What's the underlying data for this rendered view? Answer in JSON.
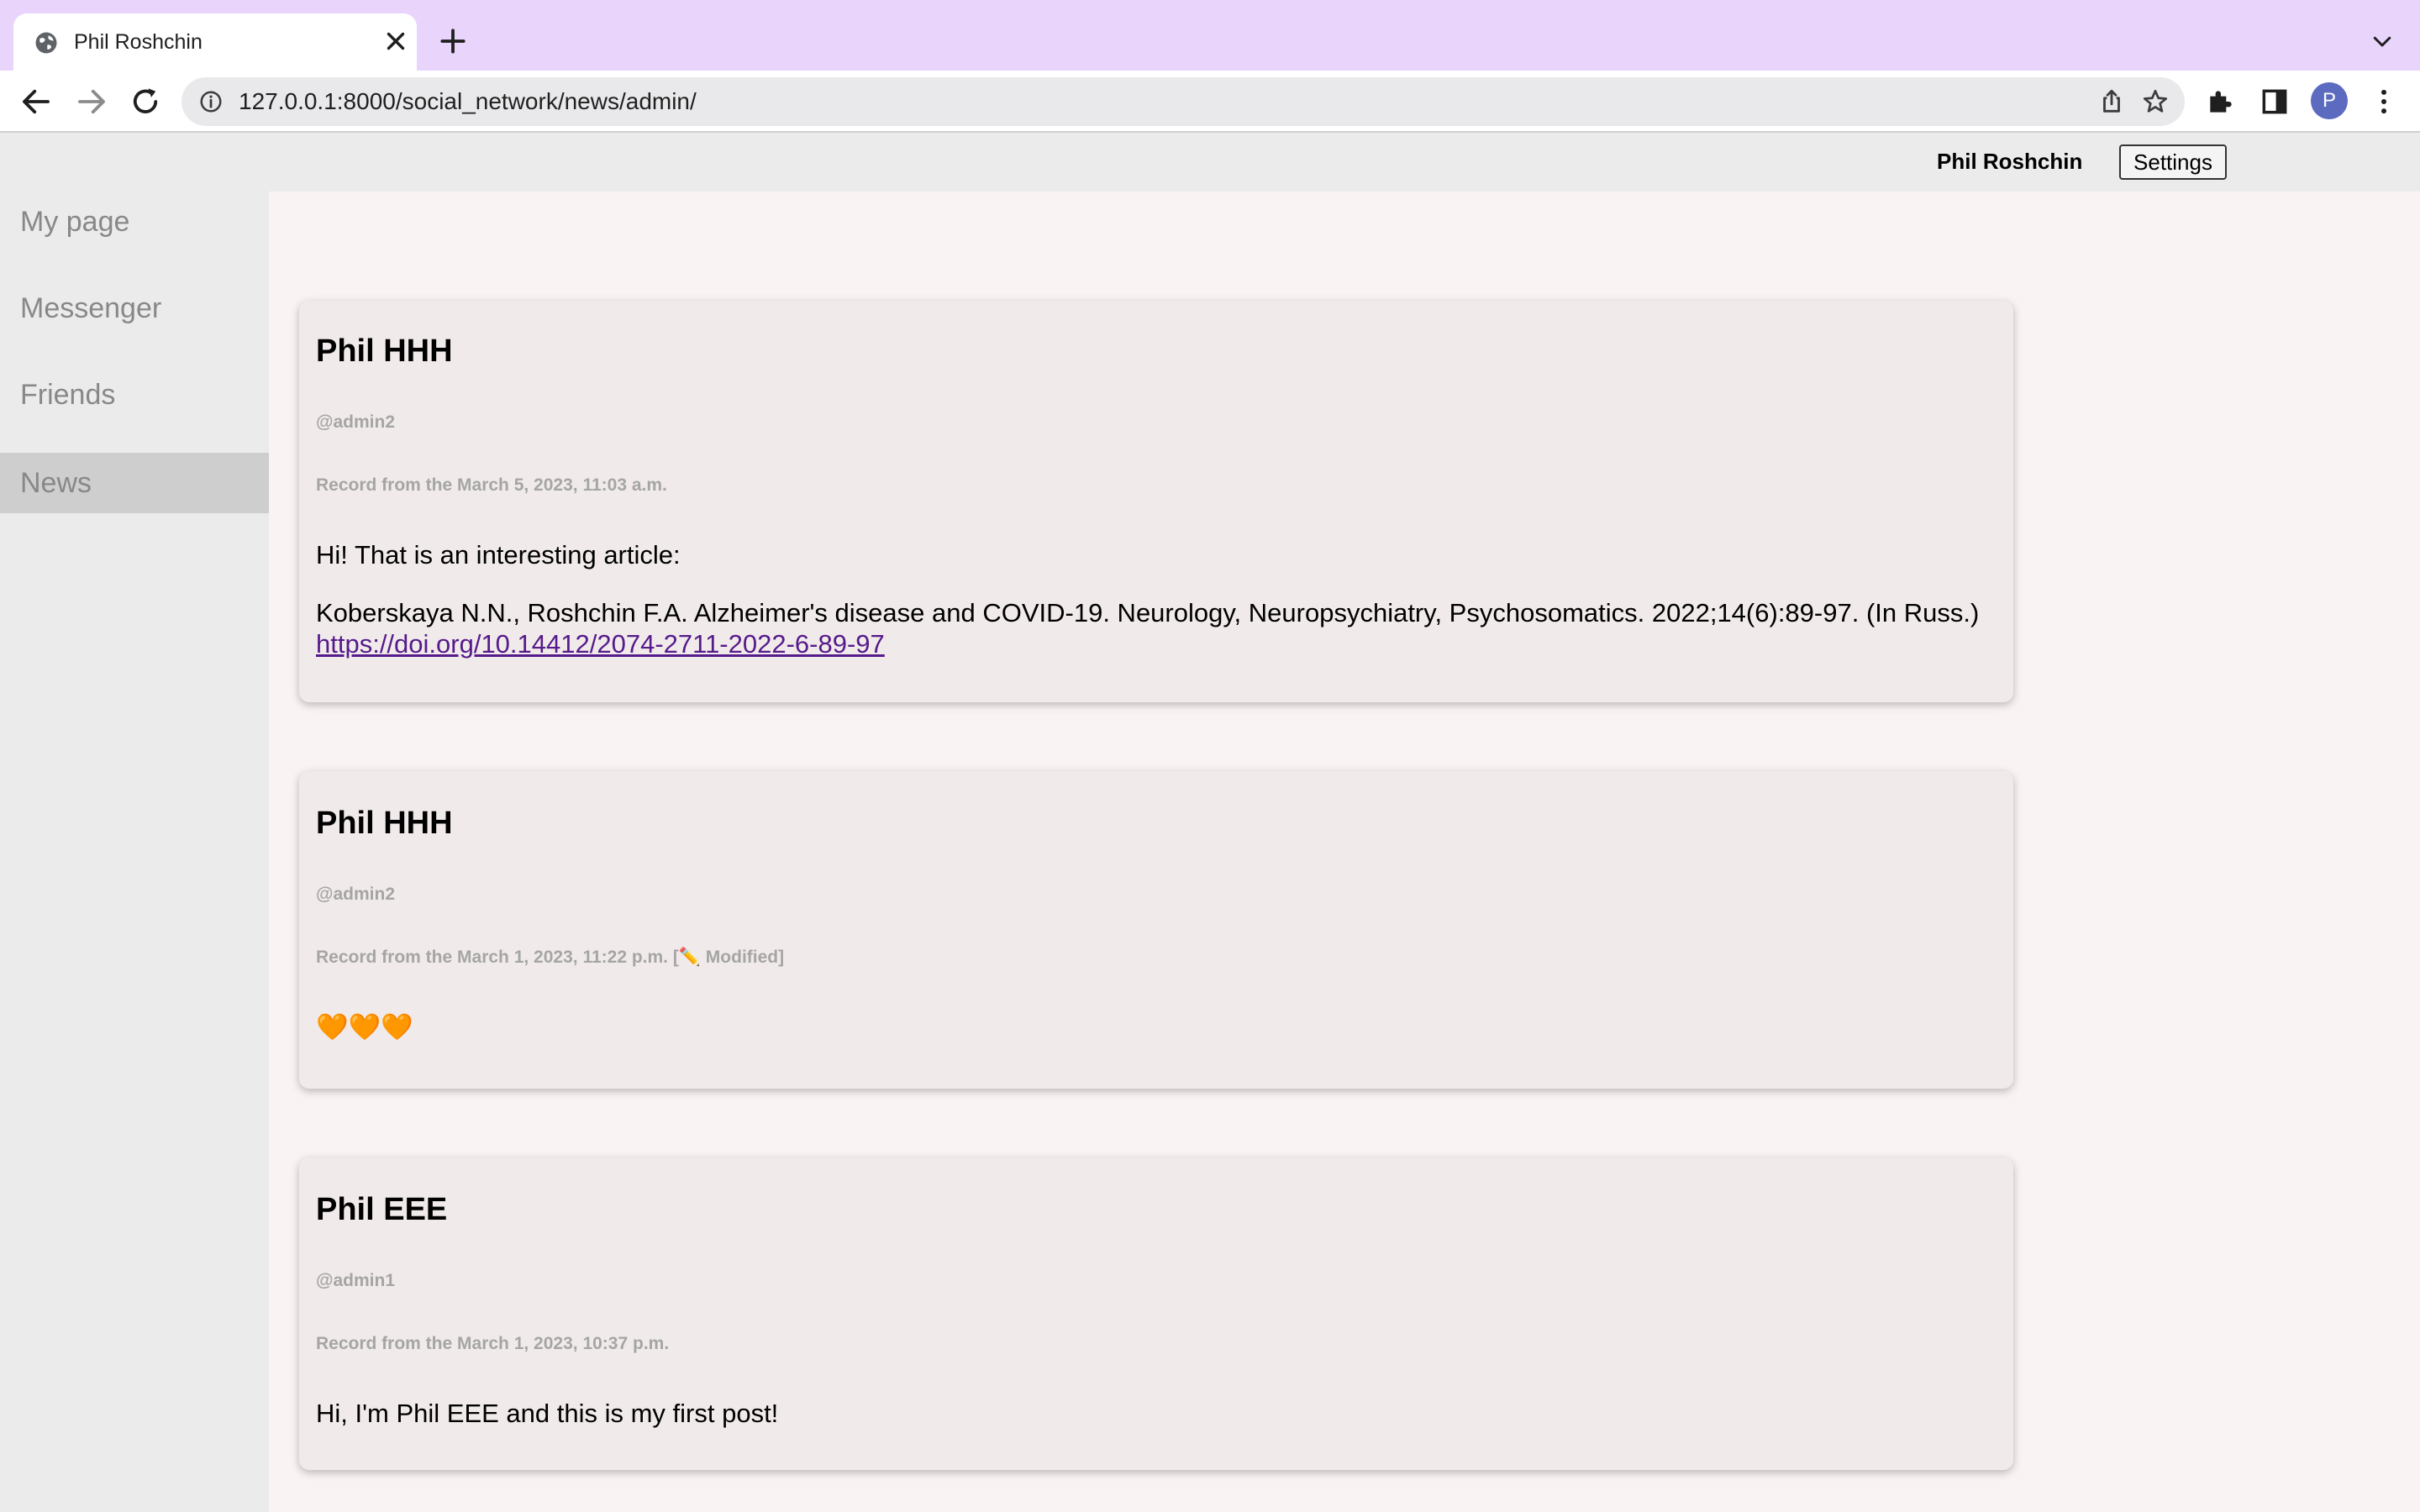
{
  "browser": {
    "tab_title": "Phil Roshchin",
    "url": "127.0.0.1:8000/social_network/news/admin/",
    "avatar_letter": "P"
  },
  "header": {
    "user_name": "Phil Roshchin",
    "settings_label": "Settings"
  },
  "sidebar": {
    "items": [
      {
        "label": "My page"
      },
      {
        "label": "Messenger"
      },
      {
        "label": "Friends"
      },
      {
        "label": "News",
        "active": true
      }
    ]
  },
  "posts": [
    {
      "author": "Phil HHH",
      "handle": "@admin2",
      "date": "Record from the March 5, 2023, 11:03 a.m.",
      "text": "Hi! That is an interesting article:",
      "text2": "Koberskaya N.N., Roshchin F.A. Alzheimer's disease and COVID-19. Neurology, Neuropsychiatry, Psychosomatics. 2022;14(6):89-97. (In Russ.) ",
      "link": "https://doi.org/10.14412/2074-2711-2022-6-89-97"
    },
    {
      "author": "Phil HHH",
      "handle": "@admin2",
      "date": "Record from the March 1, 2023, 11:22 p.m. [✏️ Modified]",
      "text": "🧡🧡🧡"
    },
    {
      "author": "Phil EEE",
      "handle": "@admin1",
      "date": "Record from the March 1, 2023, 10:37 p.m.",
      "text": "Hi, I'm Phil EEE and this is my first post!"
    }
  ],
  "colors": {
    "tab_strip": "#e9d5fb",
    "page_background": "#f9f3f3",
    "post_background": "#f1eaea",
    "sidebar_active": "#cecece",
    "link": "#551a8b"
  }
}
